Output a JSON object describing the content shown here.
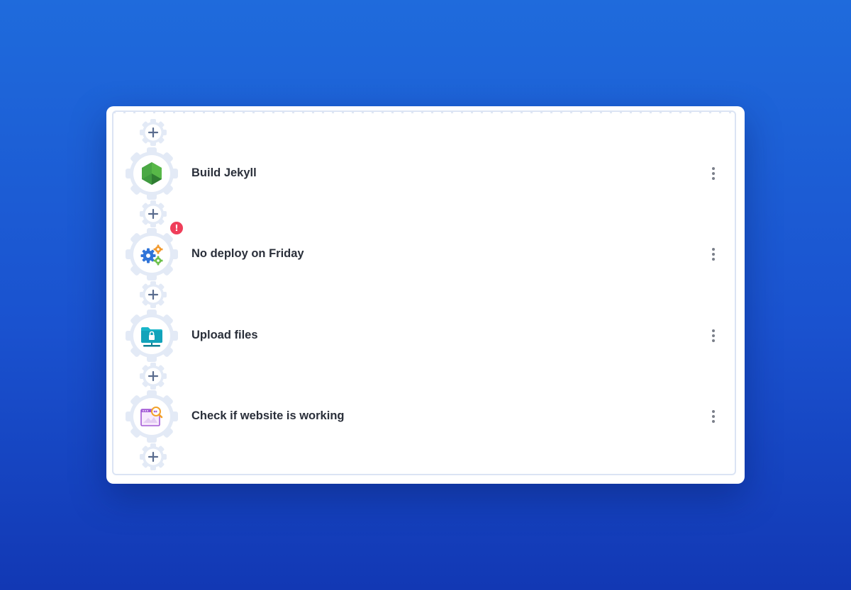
{
  "pipeline": {
    "steps": [
      {
        "label": "Build Jekyll",
        "icon": "nodejs-hexagon-icon"
      },
      {
        "label": "No deploy on Friday",
        "icon": "gears-icon",
        "badge": "!"
      },
      {
        "label": "Upload files",
        "icon": "locked-folder-upload-icon"
      },
      {
        "label": "Check if website is working",
        "icon": "browser-search-icon"
      }
    ],
    "add_step_icon": "plus-icon",
    "more_icon": "vertical-dots-icon"
  },
  "colors": {
    "background_top": "#1f6bdc",
    "background_bottom": "#1238b4",
    "card": "#ffffff",
    "gear_outline": "#dbe4f4",
    "label_text": "#2a2f3a",
    "badge": "#ef3e5a",
    "plus": "#5a6c8e"
  }
}
